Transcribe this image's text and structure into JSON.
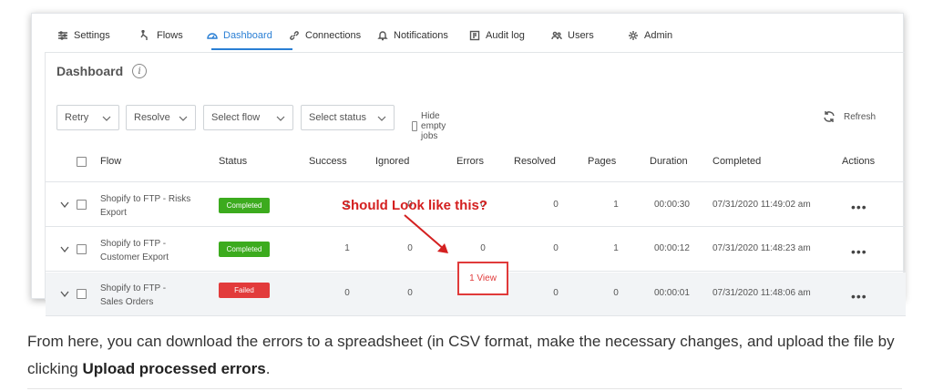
{
  "nav": {
    "items": [
      {
        "label": "Settings",
        "icon": "sliders-icon"
      },
      {
        "label": "Flows",
        "icon": "flows-icon"
      },
      {
        "label": "Dashboard",
        "icon": "dashboard-icon",
        "active": true
      },
      {
        "label": "Connections",
        "icon": "link-icon"
      },
      {
        "label": "Notifications",
        "icon": "bell-icon"
      },
      {
        "label": "Audit log",
        "icon": "audit-log-icon"
      },
      {
        "label": "Users",
        "icon": "users-icon"
      },
      {
        "label": "Admin",
        "icon": "gear-icon"
      }
    ],
    "active_color": "#2a7fd4"
  },
  "page": {
    "title": "Dashboard",
    "info_glyph": "i"
  },
  "filters": {
    "retry": "Retry",
    "resolve": "Resolve",
    "select_flow": "Select flow",
    "select_status": "Select status",
    "hide_empty": "Hide empty jobs",
    "refresh": "Refresh"
  },
  "table": {
    "columns": [
      "Flow",
      "Status",
      "Success",
      "Ignored",
      "Errors",
      "Resolved",
      "Pages",
      "Duration",
      "Completed",
      "Actions"
    ],
    "rows": [
      {
        "flow_line1": "Shopify to FTP - Risks",
        "flow_line2": "Export",
        "status": "Completed",
        "success": "1",
        "ignored": "0",
        "errors": "0",
        "resolved": "0",
        "pages": "1",
        "duration": "00:00:30",
        "completed": "07/31/2020 11:49:02 am",
        "actions": "•••"
      },
      {
        "flow_line1": "Shopify to FTP -",
        "flow_line2": "Customer Export",
        "status": "Completed",
        "success": "1",
        "ignored": "0",
        "errors": "0",
        "resolved": "0",
        "pages": "1",
        "duration": "00:00:12",
        "completed": "07/31/2020 11:48:23 am",
        "actions": "•••"
      },
      {
        "flow_line1": "Shopify to FTP -",
        "flow_line2": "Sales Orders",
        "status": "Failed",
        "success": "0",
        "ignored": "0",
        "errors": "",
        "resolved": "0",
        "pages": "0",
        "duration": "00:00:01",
        "completed": "07/31/2020 11:48:06 am",
        "actions": "•••"
      }
    ],
    "status_colors": {
      "Completed": "#3cab1e",
      "Failed": "#e23b3b"
    }
  },
  "annotation": {
    "text": "Should Look like this?",
    "box_label": "1 View",
    "color": "#d42020"
  },
  "paragraph": {
    "before": "From here, you can download the errors to a spreadsheet (in CSV format, make the necessary changes, and upload the file by clicking ",
    "bold": "Upload processed errors",
    "after": "."
  }
}
